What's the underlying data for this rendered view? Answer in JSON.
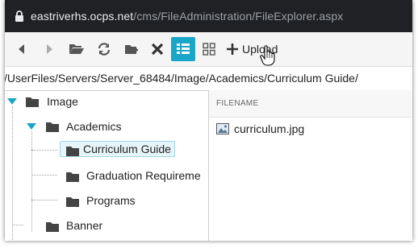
{
  "browser": {
    "host": "eastriverhs.ocps.net",
    "path": "/cms/FileAdministration/FileExplorer.aspx"
  },
  "toolbar": {
    "upload_label": "Upload",
    "buttons": [
      "back-arrow-icon",
      "forward-arrow-icon",
      "open-folder-icon",
      "refresh-icon",
      "new-folder-icon",
      "delete-icon",
      "list-view-icon",
      "grid-view-icon"
    ]
  },
  "path": "/UserFiles/Servers/Server_68484/Image/Academics/Curriculum Guide/",
  "tree": {
    "image": "Image",
    "academics": "Academics",
    "curriculum_guide": "Curriculum Guide",
    "graduation_requirements": "Graduation Requireme",
    "programs": "Programs",
    "banner": "Banner"
  },
  "list": {
    "header": "FILENAME",
    "files": [
      {
        "name": "curriculum.jpg"
      }
    ]
  },
  "colors": {
    "accent": "#1aa6c6",
    "chrome": "#202124"
  }
}
